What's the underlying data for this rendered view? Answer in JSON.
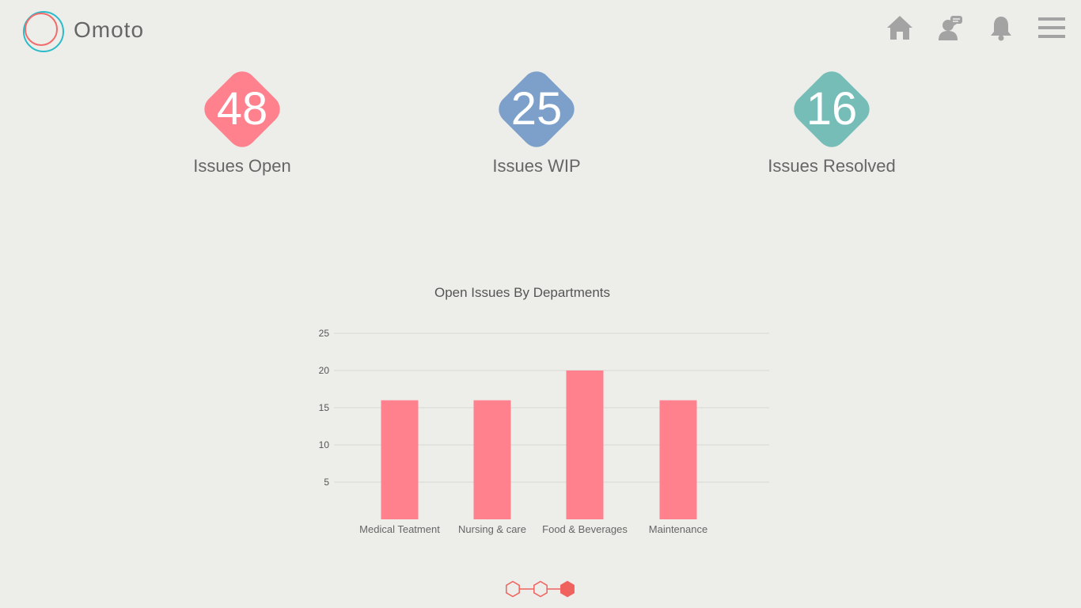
{
  "app": {
    "name": "Omoto",
    "logo_colors": [
      "#f26b6b",
      "#2bbbc9"
    ]
  },
  "nav": [
    {
      "icon": "home-icon"
    },
    {
      "icon": "support-agent-icon"
    },
    {
      "icon": "bell-icon"
    },
    {
      "icon": "menu-icon"
    }
  ],
  "stats": [
    {
      "value": "48",
      "label": "Issues Open",
      "color": "#ff818e"
    },
    {
      "value": "25",
      "label": "Issues WIP",
      "color": "#7da0cb"
    },
    {
      "value": "16",
      "label": "Issues Resolved",
      "color": "#76bdb8"
    }
  ],
  "chart_data": {
    "type": "bar",
    "title": "Open Issues By Departments",
    "categories": [
      "Medical Teatment",
      "Nursing & care",
      "Food & Beverages",
      "Maintenance"
    ],
    "values": [
      16,
      16,
      20,
      16
    ],
    "yticks": [
      5,
      10,
      15,
      20,
      25
    ],
    "ylim": [
      0,
      25
    ],
    "grid": true,
    "bar_color": "#ff818e"
  },
  "pager": {
    "pages": 3,
    "active": 3,
    "color": "#f0625e"
  }
}
